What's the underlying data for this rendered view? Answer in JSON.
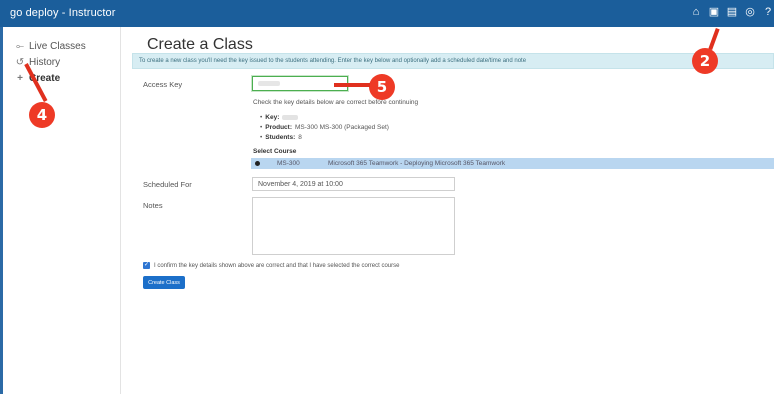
{
  "app": {
    "title": "go deploy - Instructor"
  },
  "topbar": {
    "icons": [
      "home-icon",
      "classes-icon",
      "students-icon",
      "account-icon",
      "help-icon"
    ],
    "glyphs": [
      "⌂",
      "▣",
      "▤",
      "◎",
      "?"
    ]
  },
  "sidebar": {
    "items": [
      {
        "label": "Live Classes",
        "glyph": "⟜"
      },
      {
        "label": "History",
        "glyph": "↺"
      },
      {
        "label": "Create",
        "glyph": "+"
      }
    ]
  },
  "main": {
    "title": "Create a Class",
    "info": "To create a new class you'll need the key issued to the students attending. Enter the key below and optionally add a scheduled date/time and note",
    "access_key_label": "Access Key",
    "check_text": "Check the key details below are correct before continuing",
    "details": {
      "key_label": "Key:",
      "product_label": "Product:",
      "product_value": "MS-300 MS-300 (Packaged Set)",
      "students_label": "Students:",
      "students_value": "8"
    },
    "select_course_label": "Select Course",
    "course": {
      "code": "MS-300",
      "name": "Microsoft 365 Teamwork - Deploying Microsoft 365 Teamwork"
    },
    "scheduled_label": "Scheduled For",
    "scheduled_value": "November 4, 2019 at 10:00",
    "notes_label": "Notes",
    "confirm_text": "I confirm the key details shown above are correct and that I have selected the correct course",
    "create_button": "Create Class"
  },
  "callouts": {
    "two": "2",
    "four": "4",
    "five": "5"
  },
  "colors": {
    "topbar": "#1b5e9b",
    "info_bg": "#d7edf3",
    "selected_row": "#b9d6f0",
    "button": "#1c6fc9",
    "callout": "#ee3a26"
  }
}
